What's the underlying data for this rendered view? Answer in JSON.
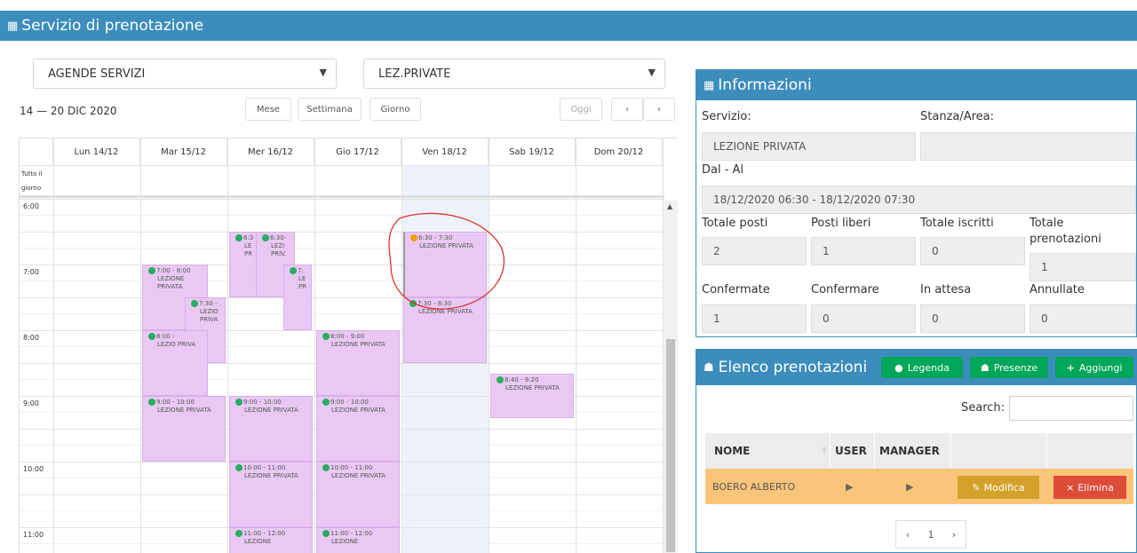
{
  "topbar": {
    "title": "Servizio di prenotazione",
    "icon": "calendar-icon"
  },
  "filters": {
    "agenda": "AGENDE SERVIZI",
    "service": "LEZ.PRIVATE"
  },
  "toolbar": {
    "range": "14 — 20 DIC 2020",
    "month": "Mese",
    "week": "Settimana",
    "day": "Giorno",
    "today": "Oggi",
    "prev": "‹",
    "next": "›"
  },
  "calendar": {
    "days": [
      "Lun 14/12",
      "Mar 15/12",
      "Mer 16/12",
      "Gio 17/12",
      "Ven 18/12",
      "Sab 19/12",
      "Dom 20/12"
    ],
    "allday": "Tutto il giorno",
    "times": [
      "6:00",
      "7:00",
      "8:00",
      "9:00",
      "10:00",
      "11:00"
    ],
    "events": [
      {
        "day": 2,
        "time": "6:3",
        "title": "LE PR"
      },
      {
        "day": 2,
        "time": "6:30-",
        "title": "LEZI PRIV."
      },
      {
        "day": 2,
        "time": "7:",
        "title": "LE PR"
      },
      {
        "day": 1,
        "time": "7:00 - 8:00",
        "title": "LEZIONE PRIVATA"
      },
      {
        "day": 1,
        "time": "7:30 - .",
        "title": "LEZIO PRIVA"
      },
      {
        "day": 1,
        "time": "8:00 - ·",
        "title": "LEZIO PRIVA"
      },
      {
        "day": 1,
        "time": "9:00 - 10:00",
        "title": "LEZIONE PRIVATA"
      },
      {
        "day": 2,
        "time": "9:00 - 10:00",
        "title": "LEZIONE PRIVATA"
      },
      {
        "day": 2,
        "time": "10:00 - 11:00",
        "title": "LEZIONE PRIVATA"
      },
      {
        "day": 2,
        "time": "11:00 - 12:00",
        "title": "LEZIONE"
      },
      {
        "day": 3,
        "time": "8:00 - 9:00",
        "title": "LEZIONE PRIVATA"
      },
      {
        "day": 3,
        "time": "9:00 - 10:00",
        "title": "LEZIONE PRIVATA"
      },
      {
        "day": 3,
        "time": "10:00 - 11:00",
        "title": "LEZIONE PRIVATA"
      },
      {
        "day": 3,
        "time": "11:00 - 12:00",
        "title": "LEZIONE"
      },
      {
        "day": 4,
        "time": "6:30 - 7:30",
        "title": "LEZIONE PRIVATA"
      },
      {
        "day": 4,
        "time": "7:30 - 8:30",
        "title": "LEZIONE PRIVATA"
      },
      {
        "day": 5,
        "time": "8:40 - 9:20",
        "title": "LEZIONE PRIVATA"
      }
    ]
  },
  "info": {
    "title": "Informazioni",
    "servizio_label": "Servizio:",
    "servizio_value": "LEZIONE PRIVATA",
    "stanza_label": "Stanza/Area:",
    "stanza_value": "",
    "dal_label": "Dal - Al",
    "dal_value": "18/12/2020 06:30 - 18/12/2020 07:30",
    "totale_posti_label": "Totale posti",
    "totale_posti": "2",
    "posti_liberi_label": "Posti liberi",
    "posti_liberi": "1",
    "totale_iscritti_label": "Totale iscritti",
    "totale_iscritti": "0",
    "totale_pren_label_1": "Totale",
    "totale_pren_label_2": "prenotazioni",
    "totale_pren": "1",
    "confermate_label": "Confermate",
    "confermate": "1",
    "confermare_label": "Confermare",
    "confermare": "0",
    "attesa_label": "In attesa",
    "attesa": "0",
    "annullate_label": "Annullate",
    "annullate": "0"
  },
  "list": {
    "title": "Elenco prenotazioni",
    "legend": "Legenda",
    "presence": "Presenze",
    "add": "Aggiungi",
    "search_label": "Search:",
    "cols": {
      "nome": "NOME",
      "user": "USER",
      "manager": "MANAGER"
    },
    "row": {
      "nome": "BOERO ALBERTO",
      "edit": "Modifica",
      "delete": "Elimina"
    },
    "pager": {
      "prev": "‹",
      "page": "1",
      "next": "›"
    }
  },
  "colors": {
    "primary": "#3c8dbc",
    "event": "#e9c9f3",
    "green": "#00a65a",
    "row": "#f9c57a",
    "edit": "#d4a12a",
    "delete": "#dd4b39"
  }
}
